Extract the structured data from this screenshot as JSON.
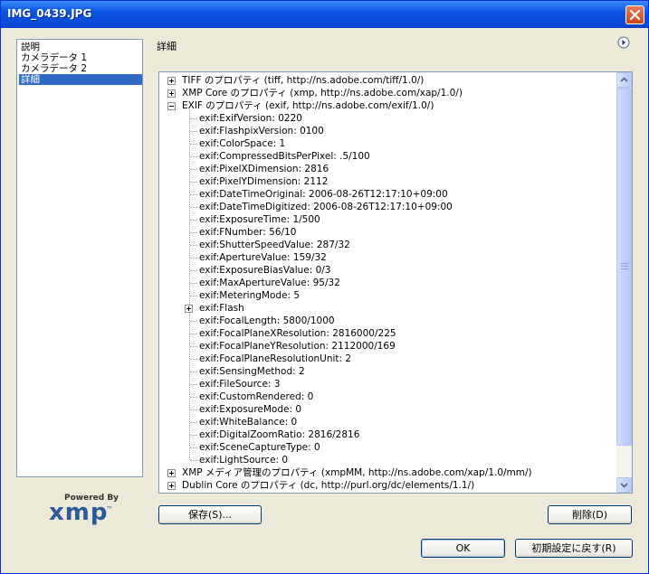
{
  "window": {
    "title": "IMG_0439.JPG"
  },
  "categories": [
    {
      "label": "説明"
    },
    {
      "label": "カメラデータ 1"
    },
    {
      "label": "カメラデータ 2"
    },
    {
      "label": "詳細"
    }
  ],
  "panel": {
    "title": "詳細"
  },
  "tree": [
    {
      "label": "TIFF のプロパティ (tiff, http://ns.adobe.com/tiff/1.0/)",
      "level": 0,
      "expander": "plus"
    },
    {
      "label": "XMP Core のプロパティ (xmp, http://ns.adobe.com/xap/1.0/)",
      "level": 0,
      "expander": "plus"
    },
    {
      "label": "EXIF のプロパティ (exif, http://ns.adobe.com/exif/1.0/)",
      "level": 0,
      "expander": "minus"
    },
    {
      "label": "exif:ExifVersion: 0220",
      "level": 1
    },
    {
      "label": "exif:FlashpixVersion: 0100",
      "level": 1
    },
    {
      "label": "exif:ColorSpace: 1",
      "level": 1
    },
    {
      "label": "exif:CompressedBitsPerPixel: .5/100",
      "level": 1
    },
    {
      "label": "exif:PixelXDimension: 2816",
      "level": 1
    },
    {
      "label": "exif:PixelYDimension: 2112",
      "level": 1
    },
    {
      "label": "exif:DateTimeOriginal: 2006-08-26T12:17:10+09:00",
      "level": 1
    },
    {
      "label": "exif:DateTimeDigitized: 2006-08-26T12:17:10+09:00",
      "level": 1
    },
    {
      "label": "exif:ExposureTime: 1/500",
      "level": 1
    },
    {
      "label": "exif:FNumber: 56/10",
      "level": 1
    },
    {
      "label": "exif:ShutterSpeedValue: 287/32",
      "level": 1
    },
    {
      "label": "exif:ApertureValue: 159/32",
      "level": 1
    },
    {
      "label": "exif:ExposureBiasValue: 0/3",
      "level": 1
    },
    {
      "label": "exif:MaxApertureValue: 95/32",
      "level": 1
    },
    {
      "label": "exif:MeteringMode: 5",
      "level": 1
    },
    {
      "label": "exif:Flash",
      "level": 1,
      "expander": "plus"
    },
    {
      "label": "exif:FocalLength: 5800/1000",
      "level": 1
    },
    {
      "label": "exif:FocalPlaneXResolution: 2816000/225",
      "level": 1
    },
    {
      "label": "exif:FocalPlaneYResolution: 2112000/169",
      "level": 1
    },
    {
      "label": "exif:FocalPlaneResolutionUnit: 2",
      "level": 1
    },
    {
      "label": "exif:SensingMethod: 2",
      "level": 1
    },
    {
      "label": "exif:FileSource: 3",
      "level": 1
    },
    {
      "label": "exif:CustomRendered: 0",
      "level": 1
    },
    {
      "label": "exif:ExposureMode: 0",
      "level": 1
    },
    {
      "label": "exif:WhiteBalance: 0",
      "level": 1
    },
    {
      "label": "exif:DigitalZoomRatio: 2816/2816",
      "level": 1
    },
    {
      "label": "exif:SceneCaptureType: 0",
      "level": 1
    },
    {
      "label": "exif:LightSource: 0",
      "level": 1
    },
    {
      "label": "XMP メディア管理のプロパティ (xmpMM, http://ns.adobe.com/xap/1.0/mm/)",
      "level": 0,
      "expander": "plus"
    },
    {
      "label": "Dublin Core のプロパティ (dc, http://purl.org/dc/elements/1.1/)",
      "level": 0,
      "expander": "plus"
    }
  ],
  "logo": {
    "powered_by": "Powered By",
    "brand": "xmp",
    "tm": "™"
  },
  "buttons": {
    "save": "保存(S)...",
    "delete": "削除(D)",
    "ok": "OK",
    "reset": "初期設定に戻す(R)"
  },
  "icons": {
    "close": "close-icon",
    "panel_menu": "circle-arrow-right-icon",
    "scroll_up": "chevron-up-icon",
    "scroll_down": "chevron-down-icon"
  },
  "colors": {
    "titlebar": "#0a54e2",
    "selection": "#316ac5",
    "dialog_bg": "#ece9d8",
    "close_button": "#d04418"
  }
}
